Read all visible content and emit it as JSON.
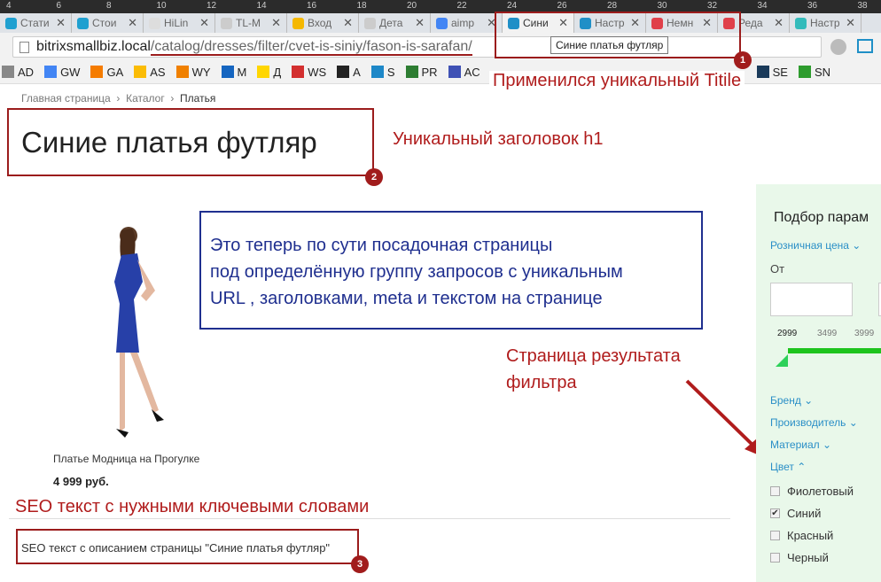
{
  "ruler": [
    "4",
    "6",
    "8",
    "10",
    "12",
    "14",
    "16",
    "18",
    "20",
    "22",
    "24",
    "26",
    "28",
    "30",
    "32",
    "34",
    "36",
    "38"
  ],
  "tabs": [
    {
      "title": "Стати",
      "color": "#1fa0d0"
    },
    {
      "title": "Стои",
      "color": "#1fa0d0"
    },
    {
      "title": "HiLin",
      "color": "#ddd"
    },
    {
      "title": "TL-M",
      "color": "#ccc"
    },
    {
      "title": "Вход",
      "color": "#f5b800"
    },
    {
      "title": "Дета",
      "color": "#ccc"
    },
    {
      "title": "aimp",
      "color": "#4285f4"
    },
    {
      "title": "Сини",
      "color": "#1f8fc7",
      "active": true
    },
    {
      "title": "Настр",
      "color": "#1f8fc7"
    },
    {
      "title": "Немн",
      "color": "#e0404a"
    },
    {
      "title": "Реда",
      "color": "#e0404a"
    },
    {
      "title": "Настр",
      "color": "#3bb"
    }
  ],
  "tab_close": "✕",
  "tooltip": "Синие платья футляр",
  "url": {
    "host": "bitrixsmallbiz.local",
    "path": "/catalog/dresses/filter/cvet-is-siniy/fason-is-sarafan/"
  },
  "bookmarks": [
    {
      "label": "AD",
      "color": "#888"
    },
    {
      "label": "GW",
      "color": "#4285f4"
    },
    {
      "label": "GA",
      "color": "#f57c00"
    },
    {
      "label": "AS",
      "color": "#fbbc05"
    },
    {
      "label": "WY",
      "color": "#f08000"
    },
    {
      "label": "M",
      "color": "#1565c0"
    },
    {
      "label": "Д",
      "color": "#ffd600"
    },
    {
      "label": "WS",
      "color": "#d32f2f"
    },
    {
      "label": "A",
      "color": "#222"
    },
    {
      "label": "S",
      "color": "#1e88c8"
    },
    {
      "label": "PR",
      "color": "#2e7d32"
    },
    {
      "label": "AC",
      "color": "#3f51b5"
    },
    {
      "label": "SE",
      "color": "#1a3a5a"
    },
    {
      "label": "SN",
      "color": "#2e9c2e"
    }
  ],
  "breadcrumb": [
    "Главная страница",
    "Каталог",
    "Платья"
  ],
  "breadcrumb_sep": "›",
  "h1": "Синие платья футляр",
  "annotations": {
    "title": "Применился уникальный Titile",
    "h1": "Уникальный заголовок h1",
    "landing": [
      "Это теперь по сути посадочная страницы",
      "под определённую группу запросов с уникальным",
      "URL , заголовками, meta и текстом на странице"
    ],
    "filter": [
      "Страница результата",
      "фильтра"
    ],
    "seo": "SEO текст с нужными ключевыми словами",
    "badges": [
      "1",
      "2",
      "3"
    ]
  },
  "product": {
    "name": "Платье Модница на Прогулке",
    "price": "4 999 руб."
  },
  "seo_text": "SEO текст с описанием страницы \"Синие платья футляр\"",
  "filter": {
    "title": "Подбор парам",
    "price_label": "Розничная цена ⌄",
    "from": "От",
    "ticks": [
      "2999",
      "3499",
      "3999"
    ],
    "sections": [
      "Бренд ⌄",
      "Производитель ⌄",
      "Материал ⌄",
      "Цвет ⌃"
    ],
    "colors": [
      {
        "label": "Фиолетовый",
        "checked": false
      },
      {
        "label": "Синий",
        "checked": true
      },
      {
        "label": "Красный",
        "checked": false
      },
      {
        "label": "Черный",
        "checked": false
      }
    ]
  },
  "accent": "#9b1c1c"
}
